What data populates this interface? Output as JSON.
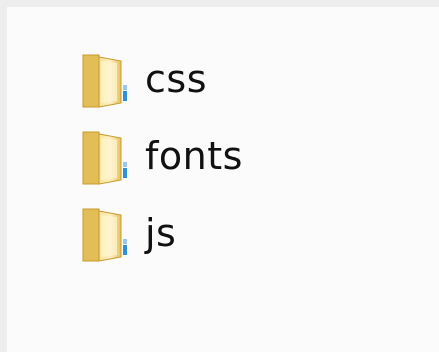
{
  "explorer": {
    "items": [
      {
        "label": "css",
        "icon": "folder-icon"
      },
      {
        "label": "fonts",
        "icon": "folder-icon"
      },
      {
        "label": "js",
        "icon": "folder-icon"
      }
    ]
  },
  "colors": {
    "background": "#fbfbfb",
    "folder_light": "#fbe8a4",
    "folder_mid": "#e8c765",
    "folder_dark": "#c89a2a",
    "accent_blue": "#2f8fd8"
  }
}
